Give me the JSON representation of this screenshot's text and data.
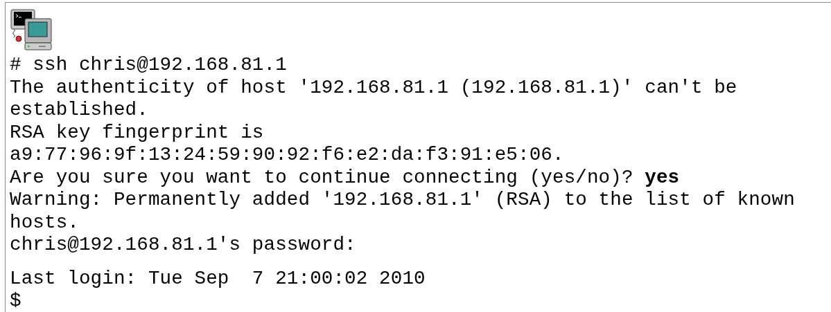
{
  "transcript": [
    "# ssh chris@192.168.81.1",
    "The authenticity of host '192.168.81.1 (192.168.81.1)' can't be",
    "established.",
    "RSA key fingerprint is",
    "a9:77:96:9f:13:24:59:90:92:f6:e2:da:f3:91:e5:06.",
    "Are you sure you want to continue connecting (yes/no)? **yes**",
    "Warning: Permanently added '192.168.81.1' (RSA) to the list of known",
    "hosts.",
    "chris@192.168.81.1's password:"
  ],
  "login_banner": [
    "Last login: Tue Sep  7 21:00:02 2010",
    "$"
  ]
}
